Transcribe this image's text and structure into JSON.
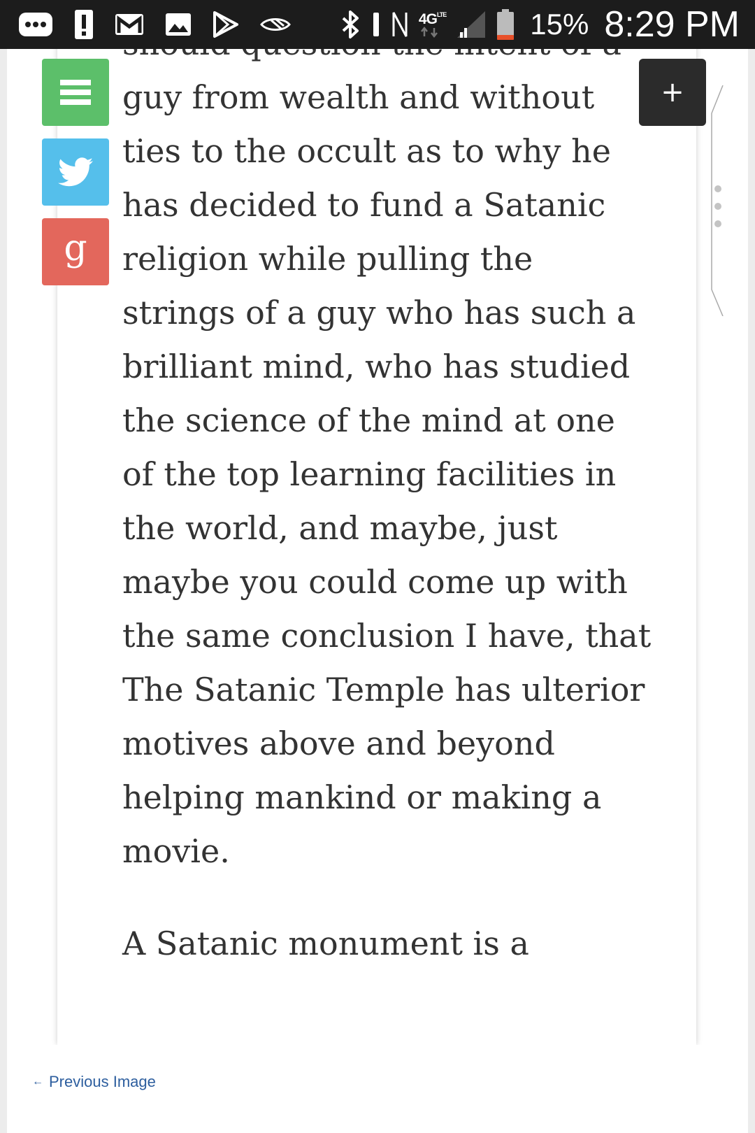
{
  "status_bar": {
    "network_label": "4G",
    "network_sub": "LTE",
    "battery_percent": "15%",
    "time": "8:29 PM",
    "colors": {
      "battery_low": "#e8502a"
    },
    "icons": [
      "more-notifications-icon",
      "alert-icon",
      "gmail-icon",
      "gallery-icon",
      "play-store-icon",
      "cast-icon",
      "bluetooth-icon",
      "vibrate-icon",
      "nfc-icon",
      "signal-icon",
      "battery-icon"
    ]
  },
  "share_bar": {
    "buttons": [
      {
        "name": "menu",
        "icon": "menu-icon",
        "color": "#5cbf6a"
      },
      {
        "name": "twitter",
        "icon": "twitter-icon",
        "color": "#55bfeb"
      },
      {
        "name": "google-plus",
        "icon": "google-icon",
        "glyph": "g",
        "color": "#e3675c"
      }
    ]
  },
  "plus_button": {
    "label": "+"
  },
  "article": {
    "paragraphs": [
      "should question the intent of a guy from wealth and without ties to the occult as to why he has decided to fund a Satanic religion while pulling the strings of a guy who has such a brilliant mind, who has studied the science of the mind at one of the top learning facilities in the world, and maybe, just maybe you could come up with the same conclusion I have, that The Satanic Temple has ulterior motives above and beyond helping mankind or making a movie.",
      "A Satanic monument is a"
    ]
  },
  "footer": {
    "prev_arrow": "←",
    "prev_label": "Previous Image"
  }
}
